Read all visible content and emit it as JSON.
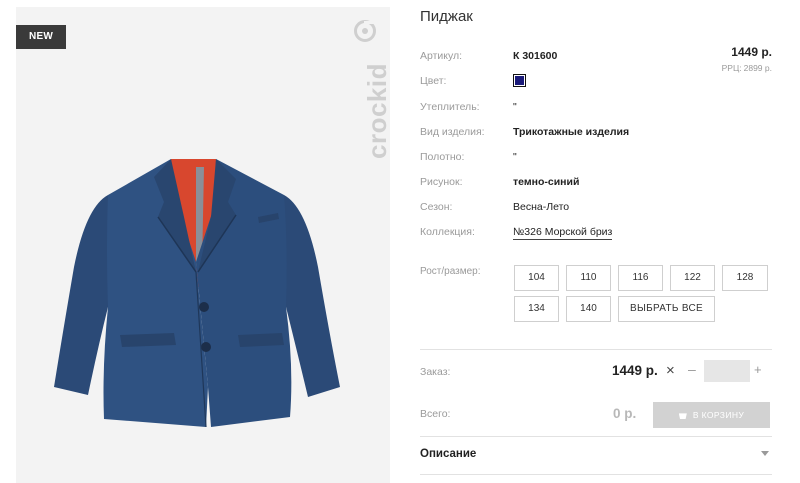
{
  "product": {
    "badge": "NEW",
    "brand": "crockid",
    "title": "Пиджак",
    "price": "1449 р.",
    "rrp_label": "РРЦ:",
    "rrp_value": "2899 р.",
    "specs": [
      {
        "label": "Артикул:",
        "value": "К 301600"
      },
      {
        "label": "Цвет:",
        "value": ""
      },
      {
        "label": "Утеплитель:",
        "value": "\""
      },
      {
        "label": "Вид изделия:",
        "value": "Трикотажные изделия"
      },
      {
        "label": "Полотно:",
        "value": "\""
      },
      {
        "label": "Рисунок:",
        "value": "темно-синий"
      },
      {
        "label": "Сезон:",
        "value": "Весна-Лето"
      },
      {
        "label": "Коллекция:",
        "value": "№326 Морской бриз"
      }
    ],
    "color_hex": "#1a1a7a"
  },
  "sizes": {
    "label": "Рост/размер:",
    "items": [
      "104",
      "110",
      "116",
      "122",
      "128",
      "134",
      "140"
    ],
    "select_all": "ВЫБРАТЬ ВСЕ"
  },
  "order": {
    "label": "Заказ:",
    "price": "1449 р.",
    "times": "×",
    "minus": "–",
    "plus": "+",
    "quantity": ""
  },
  "total": {
    "label": "Всего:",
    "value": "0 р.",
    "cart_button": "В КОРЗИНУ"
  },
  "description": {
    "label": "Описание"
  }
}
